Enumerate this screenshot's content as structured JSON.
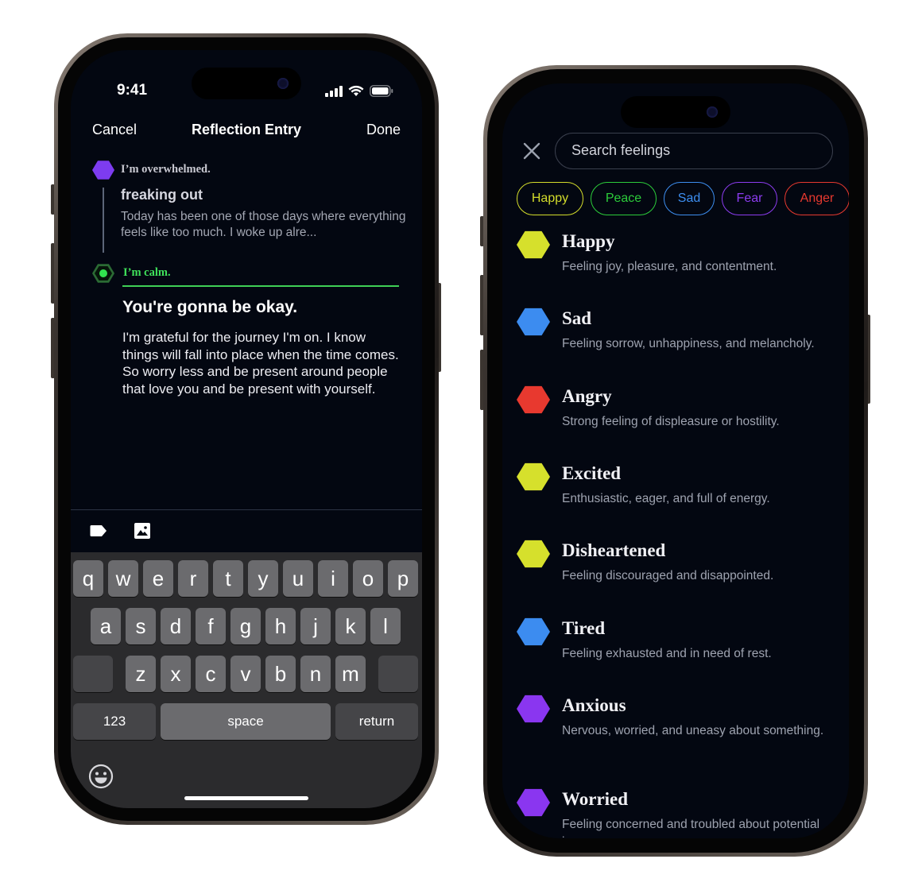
{
  "left": {
    "status": {
      "time": "9:41"
    },
    "nav": {
      "cancel": "Cancel",
      "title": "Reflection Entry",
      "done": "Done"
    },
    "entry1": {
      "feeling": "I’m overwhelmed.",
      "subject": "freaking out",
      "body": "Today has been one of those days where everything feels like too much. I woke up alre...",
      "color": "#7d3cf0"
    },
    "entry2": {
      "feeling": "I’m calm.",
      "subject": "You're gonna be okay.",
      "body": "I'm grateful for the journey I'm on. I know things will fall into place when the time comes. So worry less and be present around people that love you and be present with yourself.",
      "color": "#31e24f"
    },
    "toolbar": {
      "tag_icon": "tag-icon",
      "image_icon": "image-icon"
    },
    "keyboard": {
      "row1": [
        "q",
        "w",
        "e",
        "r",
        "t",
        "y",
        "u",
        "i",
        "o",
        "p"
      ],
      "row2": [
        "a",
        "s",
        "d",
        "f",
        "g",
        "h",
        "j",
        "k",
        "l"
      ],
      "row3": [
        "z",
        "x",
        "c",
        "v",
        "b",
        "n",
        "m"
      ],
      "numbers": "123",
      "space": "space",
      "return": "return"
    }
  },
  "right": {
    "search": {
      "placeholder": "Search feelings"
    },
    "chips": [
      {
        "label": "Happy",
        "color": "#d4dd2b"
      },
      {
        "label": "Peace",
        "color": "#2ccc3a"
      },
      {
        "label": "Sad",
        "color": "#3d8ef0"
      },
      {
        "label": "Fear",
        "color": "#8c3cf0"
      },
      {
        "label": "Anger",
        "color": "#e8392f"
      }
    ],
    "feelings": [
      {
        "name": "Happy",
        "desc": "Feeling joy, pleasure, and contentment.",
        "color": "#d6e02c"
      },
      {
        "name": "Sad",
        "desc": "Feeling sorrow, unhappiness, and melancholy.",
        "color": "#3c8cf0"
      },
      {
        "name": "Angry",
        "desc": "Strong feeling of displeasure or hostility.",
        "color": "#e8392f"
      },
      {
        "name": "Excited",
        "desc": "Enthusiastic, eager, and full of energy.",
        "color": "#d6e02c"
      },
      {
        "name": "Disheartened",
        "desc": "Feeling discouraged and disappointed.",
        "color": "#d6e02c"
      },
      {
        "name": "Tired",
        "desc": "Feeling exhausted and in need of rest.",
        "color": "#3c8cf0"
      },
      {
        "name": "Anxious",
        "desc": "Nervous, worried, and uneasy about something.",
        "color": "#8a36f0"
      },
      {
        "name": "Worried",
        "desc": "Feeling concerned and troubled about potential issues.",
        "color": "#8a36f0"
      }
    ]
  }
}
